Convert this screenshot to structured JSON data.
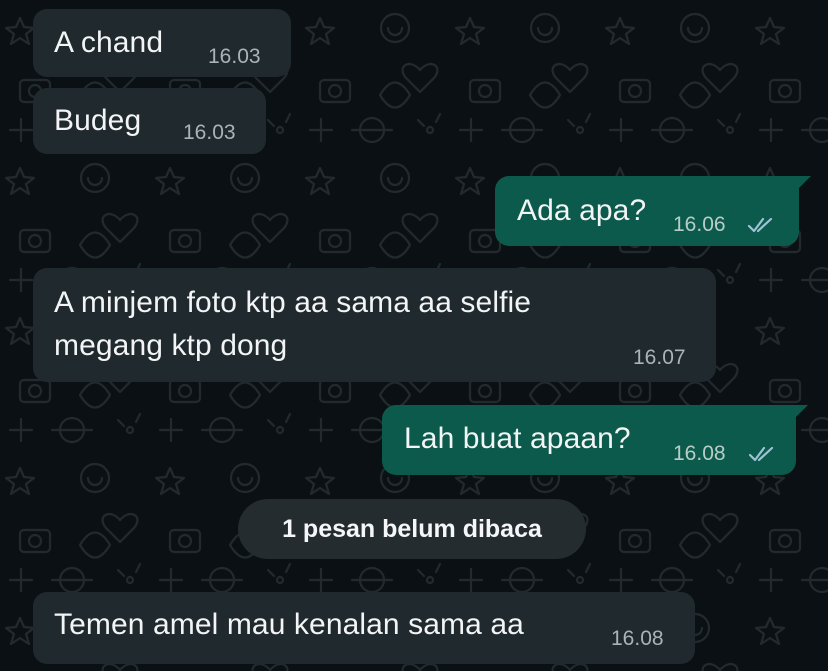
{
  "chat": {
    "messages": [
      {
        "text": "A chand",
        "time": "16.03"
      },
      {
        "text": "Budeg",
        "time": "16.03"
      },
      {
        "text": "Ada apa?",
        "time": "16.06",
        "status": "read"
      },
      {
        "line1": "A minjem foto ktp aa sama aa selfie",
        "line2": "megang ktp dong",
        "time": "16.07"
      },
      {
        "text": "Lah buat apaan?",
        "time": "16.08",
        "status": "read"
      },
      {
        "text": "Temen amel mau kenalan sama aa",
        "time": "16.08"
      }
    ],
    "unread_banner": "1 pesan belum dibaca"
  },
  "colors": {
    "background": "#0b1014",
    "incoming_bubble": "#20292e",
    "outgoing_bubble": "#0b5a4b",
    "read_ticks": "#9fc3d6"
  },
  "icons": {
    "read_receipt": "double-check-icon",
    "wallpaper": "doodle-pattern"
  }
}
